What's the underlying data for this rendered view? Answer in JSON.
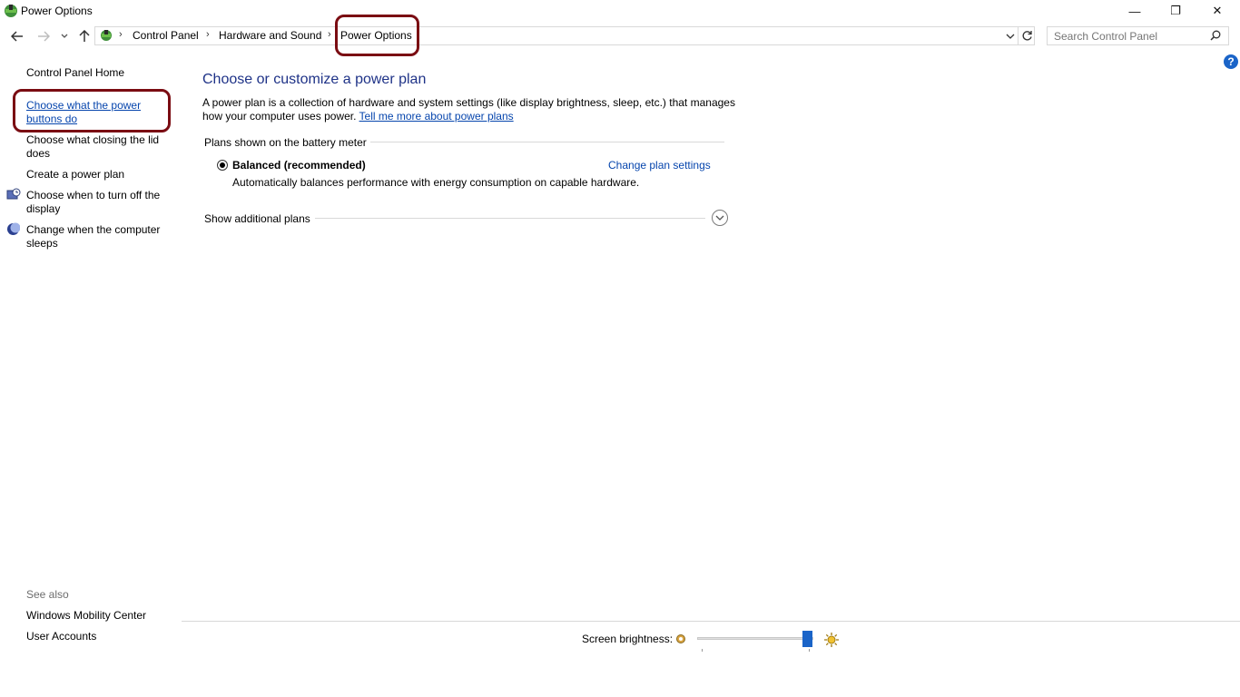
{
  "window": {
    "title": "Power Options",
    "controls": {
      "minimize": "—",
      "restore": "❐",
      "close": "✕"
    }
  },
  "nav": {
    "back_icon": "arrow-left-icon",
    "forward_icon": "arrow-right-icon",
    "recent_icon": "chevron-down-icon",
    "up_icon": "arrow-up-icon"
  },
  "breadcrumb": [
    "Control Panel",
    "Hardware and Sound",
    "Power Options"
  ],
  "search": {
    "placeholder": "Search Control Panel"
  },
  "sidebar": {
    "home": "Control Panel Home",
    "items": [
      {
        "label": "Choose what the power buttons do",
        "highlighted": true
      },
      {
        "label": "Choose what closing the lid does"
      },
      {
        "label": "Create a power plan"
      },
      {
        "label": "Choose when to turn off the display",
        "icon": "display-timer-icon"
      },
      {
        "label": "Change when the computer sleeps",
        "icon": "moon-icon"
      }
    ],
    "see_also_title": "See also",
    "see_also": [
      "Windows Mobility Center",
      "User Accounts"
    ]
  },
  "main": {
    "title": "Choose or customize a power plan",
    "description": "A power plan is a collection of hardware and system settings (like display brightness, sleep, etc.) that manages how your computer uses power. ",
    "learn_more_link": "Tell me more about power plans",
    "group_label": "Plans shown on the battery meter",
    "plan": {
      "name": "Balanced (recommended)",
      "selected": true,
      "change_link": "Change plan settings",
      "description": "Automatically balances performance with energy consumption on capable hardware."
    },
    "show_additional": "Show additional plans"
  },
  "brightness": {
    "label": "Screen brightness:",
    "value_percent": 95
  },
  "colors": {
    "link": "#0645ad",
    "title": "#1e3287",
    "highlight_ring": "#7a0c12",
    "accent": "#1a64c8"
  }
}
